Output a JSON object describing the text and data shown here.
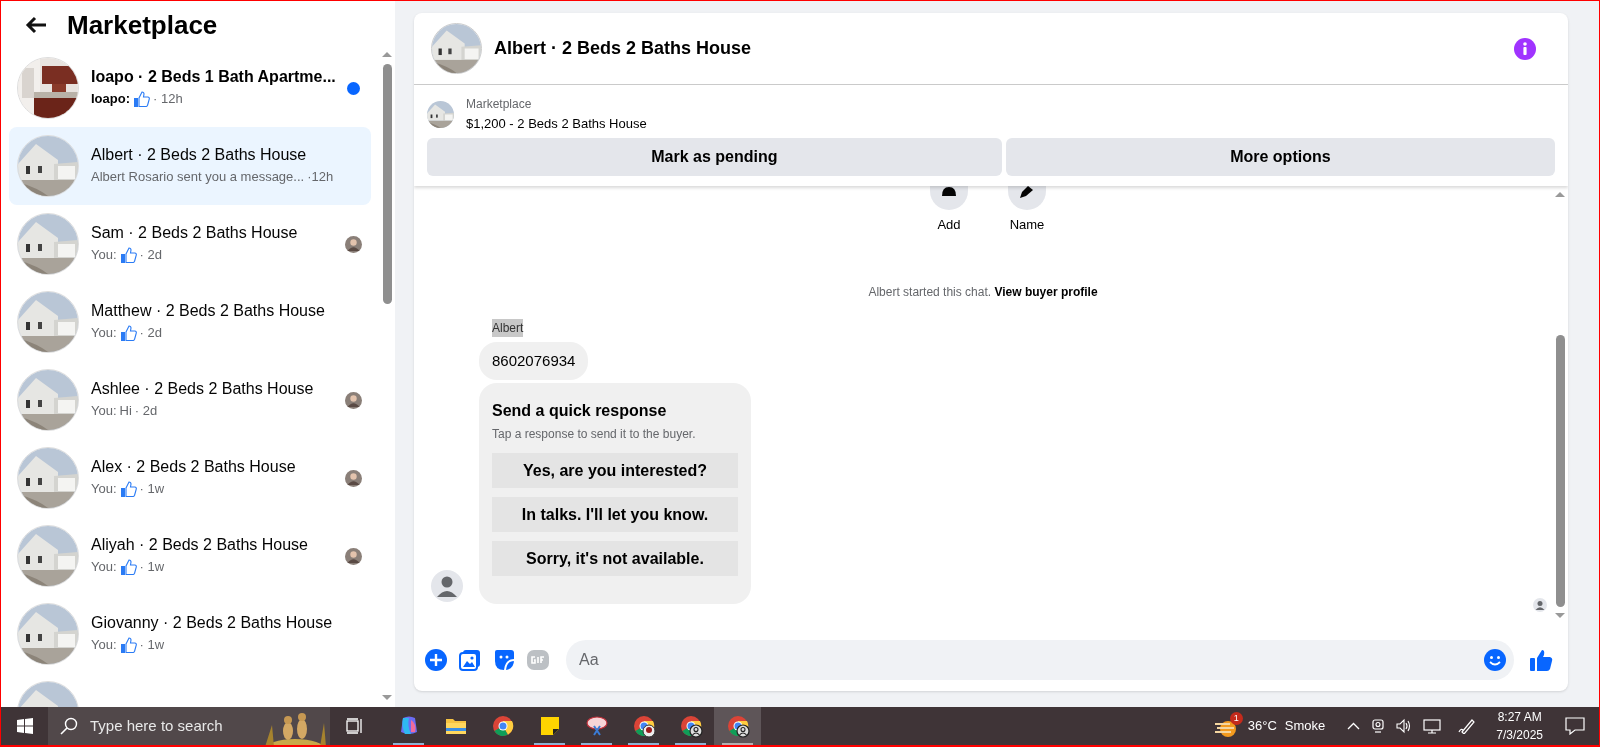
{
  "sidebar": {
    "title": "Marketplace",
    "conversations": [
      {
        "title": "Ioapo · 2 Beds 1 Bath Apartme...",
        "sender": "Ioapo:",
        "like": true,
        "time": "· 12h",
        "unread": true,
        "selected": false,
        "seen": false
      },
      {
        "title": "Albert · 2 Beds 2 Baths House",
        "message": "Albert Rosario sent you a message...",
        "time": "·12h",
        "like": false,
        "unread": false,
        "selected": true,
        "seen": false
      },
      {
        "title": "Sam · 2 Beds 2 Baths House",
        "sender": "You:",
        "like": true,
        "time": "· 2d",
        "unread": false,
        "selected": false,
        "seen": true
      },
      {
        "title": "Matthew · 2 Beds 2 Baths House",
        "sender": "You:",
        "like": true,
        "time": "· 2d",
        "unread": false,
        "selected": false,
        "seen": false
      },
      {
        "title": "Ashlee · 2 Beds 2 Baths House",
        "sender": "You:",
        "message": "Hi",
        "time": "· 2d",
        "like": false,
        "unread": false,
        "selected": false,
        "seen": true
      },
      {
        "title": "Alex · 2 Beds 2 Baths House",
        "sender": "You:",
        "like": true,
        "time": "· 1w",
        "unread": false,
        "selected": false,
        "seen": true
      },
      {
        "title": "Aliyah · 2 Beds 2 Baths House",
        "sender": "You:",
        "like": true,
        "time": "· 1w",
        "unread": false,
        "selected": false,
        "seen": true
      },
      {
        "title": "Giovanny · 2 Beds 2 Baths House",
        "sender": "You:",
        "like": true,
        "time": "· 1w",
        "unread": false,
        "selected": false,
        "seen": false
      },
      {
        "like": false,
        "unread": false,
        "selected": false,
        "seen": false
      }
    ]
  },
  "chat": {
    "title": "Albert · 2 Beds 2 Baths House",
    "listing": {
      "label": "Marketplace",
      "name": "$1,200 - 2 Beds 2 Baths House"
    },
    "actions": [
      "Mark as pending",
      "More options"
    ],
    "profile_actions": [
      {
        "label": "Add",
        "kind": "person"
      },
      {
        "label": "Name",
        "kind": "pencil"
      }
    ],
    "notice": {
      "text": "Albert started this chat.",
      "link": "View buyer profile"
    },
    "sender": "Albert",
    "message": "8602076934",
    "quick_response": {
      "title": "Send a quick response",
      "subtitle": "Tap a response to send it to the buyer.",
      "options": [
        "Yes, are you interested?",
        "In talks. I'll let you know.",
        "Sorry, it's not available."
      ]
    },
    "composer": {
      "placeholder": "Aa"
    }
  },
  "taskbar": {
    "search_placeholder": "Type here to search",
    "apps": [
      {
        "kind": "copilot",
        "running": true,
        "selected": false
      },
      {
        "kind": "folder",
        "running": false,
        "selected": false
      },
      {
        "kind": "browser",
        "running": false,
        "selected": false
      },
      {
        "kind": "note",
        "running": true,
        "selected": false
      },
      {
        "kind": "snip",
        "running": true,
        "selected": false
      },
      {
        "kind": "browser_badge",
        "running": true,
        "selected": false
      },
      {
        "kind": "browser_profile",
        "running": true,
        "selected": false
      },
      {
        "kind": "browser_profile",
        "running": true,
        "selected": true
      }
    ],
    "weather": {
      "badge": "1",
      "temperature": "36°C",
      "condition": "Smoke"
    },
    "time": "8:27 AM",
    "date": "7/3/2025"
  }
}
